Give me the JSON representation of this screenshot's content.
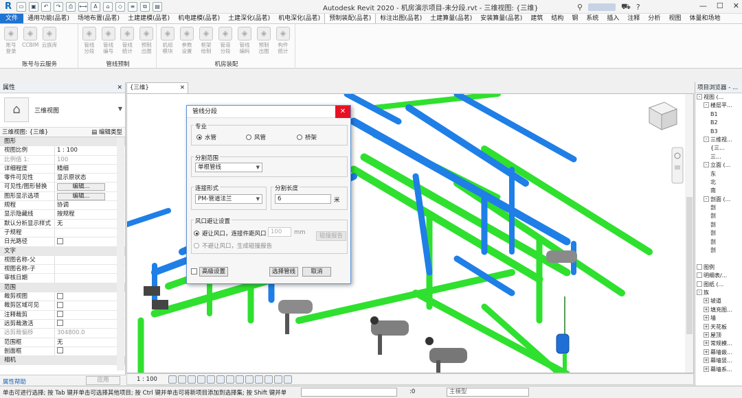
{
  "app": {
    "window_title": "Autodesk Revit 2020 - 机房演示项目-未分段.rvt - 三维视图: {三维}",
    "help_glyph": "?",
    "win_min": "—",
    "win_max": "☐",
    "win_close": "✕"
  },
  "menu": {
    "tabs": [
      "文件",
      "通用功能(品茗)",
      "场地布置(品茗)",
      "土建建模(品茗)",
      "机电建模(品茗)",
      "土建深化(品茗)",
      "机电深化(品茗)",
      "预制装配(品茗)",
      "标注出图(品茗)",
      "土建算量(品茗)",
      "安装算量(品茗)",
      "建筑",
      "结构",
      "钢",
      "系统",
      "插入",
      "注释",
      "分析",
      "视图",
      "体量和场地"
    ]
  },
  "ribbon": {
    "groups": [
      {
        "label": "账号与云服务",
        "buttons": [
          {
            "l1": "账号",
            "l2": "登录"
          },
          {
            "l1": "CCBIM",
            "l2": ""
          },
          {
            "l1": "云族库",
            "l2": ""
          }
        ]
      },
      {
        "label": "管线预制",
        "buttons": [
          {
            "l1": "管线",
            "l2": "分段"
          },
          {
            "l1": "管线",
            "l2": "编号"
          },
          {
            "l1": "管线",
            "l2": "统计"
          },
          {
            "l1": "预制",
            "l2": "出图"
          }
        ]
      },
      {
        "label": "机房装配",
        "buttons": [
          {
            "l1": "机组",
            "l2": "模块"
          },
          {
            "l1": "参数",
            "l2": "设置"
          },
          {
            "l1": "框架",
            "l2": "绘制"
          },
          {
            "l1": "管道",
            "l2": "分段"
          },
          {
            "l1": "管线",
            "l2": "编码"
          },
          {
            "l1": "预制",
            "l2": "出图"
          },
          {
            "l1": "构件",
            "l2": "统计"
          }
        ]
      }
    ]
  },
  "properties": {
    "title": "属性",
    "type_name": "三维视图",
    "view_selector": "三维视图: {三维}",
    "edit_type": "编辑类型",
    "rows": [
      {
        "k": "图形",
        "v": "",
        "section": true
      },
      {
        "k": "视图比例",
        "v": "1 : 100"
      },
      {
        "k": "比例值 1:",
        "v": "100",
        "dim": true
      },
      {
        "k": "详细程度",
        "v": "精细"
      },
      {
        "k": "零件可见性",
        "v": "显示原状态"
      },
      {
        "k": "可见性/图形替换",
        "v": "编辑...",
        "btn": true
      },
      {
        "k": "图形显示选项",
        "v": "编辑...",
        "btn": true
      },
      {
        "k": "规程",
        "v": "协调"
      },
      {
        "k": "显示隐藏线",
        "v": "按规程"
      },
      {
        "k": "默认分析显示样式",
        "v": "无"
      },
      {
        "k": "子规程",
        "v": ""
      },
      {
        "k": "日光路径",
        "v": "",
        "cb": true
      },
      {
        "k": "文字",
        "v": "",
        "section": true
      },
      {
        "k": "视图名称-父",
        "v": ""
      },
      {
        "k": "视图名称-子",
        "v": ""
      },
      {
        "k": "审核日期",
        "v": ""
      },
      {
        "k": "范围",
        "v": "",
        "section": true
      },
      {
        "k": "裁剪视图",
        "v": "",
        "cb": true
      },
      {
        "k": "裁剪区域可见",
        "v": "",
        "cb": true
      },
      {
        "k": "注释裁剪",
        "v": "",
        "cb": true
      },
      {
        "k": "远剪裁激活",
        "v": "",
        "cb": true
      },
      {
        "k": "远剪裁偏移",
        "v": "304800.0",
        "dim": true
      },
      {
        "k": "范围框",
        "v": "无"
      },
      {
        "k": "剖面框",
        "v": "",
        "cb": true
      },
      {
        "k": "相机",
        "v": "",
        "section": true
      }
    ],
    "help": "属性帮助",
    "apply": "应用"
  },
  "view": {
    "tab_label": "{三维}",
    "scale": "1 : 100"
  },
  "dialog": {
    "title": "管线分段",
    "discipline_label": "专业",
    "options": [
      "水管",
      "风管",
      "桥架"
    ],
    "selected": "水管",
    "range_label": "分割范围",
    "range_value": "单根管线",
    "conn_label": "连接形式",
    "conn_value": "PM-管道法兰",
    "length_label": "分割长度",
    "length_value": "6",
    "length_unit": "米",
    "avoid_label": "风口避让设置",
    "avoid_opt1": "避让风口，连接件距风口",
    "avoid_value": "100",
    "avoid_unit": "mm",
    "avoid_opt2": "不避让风口，生成碰撞报告",
    "collision_btn": "碰撞报告",
    "advanced": "高级设置",
    "select_btn": "选择管线",
    "cancel_btn": "取消"
  },
  "browser": {
    "title": "项目浏览器 - ...",
    "items": [
      {
        "t": "视图 (...",
        "lvl": 0,
        "tw": "-"
      },
      {
        "t": "楼层平...",
        "lvl": 1,
        "tw": "-"
      },
      {
        "t": "B1",
        "lvl": 2
      },
      {
        "t": "B2",
        "lvl": 2
      },
      {
        "t": "B3",
        "lvl": 2
      },
      {
        "t": "三维视...",
        "lvl": 1,
        "tw": "-"
      },
      {
        "t": "{三...",
        "lvl": 2
      },
      {
        "t": "三...",
        "lvl": 2
      },
      {
        "t": "立面 (...",
        "lvl": 1,
        "tw": "-"
      },
      {
        "t": "东",
        "lvl": 2
      },
      {
        "t": "北",
        "lvl": 2
      },
      {
        "t": "南",
        "lvl": 2
      },
      {
        "t": "剖面 (...",
        "lvl": 1,
        "tw": "-"
      },
      {
        "t": "剖",
        "lvl": 2
      },
      {
        "t": "剖",
        "lvl": 2
      },
      {
        "t": "剖",
        "lvl": 2
      },
      {
        "t": "剖",
        "lvl": 2
      },
      {
        "t": "剖",
        "lvl": 2
      },
      {
        "t": "剖",
        "lvl": 2
      },
      {
        "t": "",
        "lvl": 2
      },
      {
        "t": "图例",
        "lvl": 0,
        "tw": ""
      },
      {
        "t": "明细表/...",
        "lvl": 0,
        "tw": ""
      },
      {
        "t": "图纸 (...",
        "lvl": 0,
        "tw": ""
      },
      {
        "t": "族",
        "lvl": 0,
        "tw": "-"
      },
      {
        "t": "坡道",
        "lvl": 1,
        "tw": "+"
      },
      {
        "t": "填充图...",
        "lvl": 1,
        "tw": "+"
      },
      {
        "t": "墙",
        "lvl": 1,
        "tw": "+"
      },
      {
        "t": "天花板",
        "lvl": 1,
        "tw": "+"
      },
      {
        "t": "屋顶",
        "lvl": 1,
        "tw": "+"
      },
      {
        "t": "常规模...",
        "lvl": 1,
        "tw": "+"
      },
      {
        "t": "幕墙嵌...",
        "lvl": 1,
        "tw": "+"
      },
      {
        "t": "幕墙竖...",
        "lvl": 1,
        "tw": "+"
      },
      {
        "t": "幕墙系...",
        "lvl": 1,
        "tw": "+"
      }
    ]
  },
  "status": {
    "message": "单击可进行选择; 按 Tab 键并单击可选择其他项目; 按 Ctrl 键并单击可将新项目添加到选择集; 按 Shift 键并单击",
    "zero": ":0",
    "model": "主模型"
  },
  "colors": {
    "pipe_blue": "#1f7fe6",
    "pipe_green": "#2fe02f",
    "file_tab": "#1f74d2",
    "close_red": "#e81123"
  }
}
